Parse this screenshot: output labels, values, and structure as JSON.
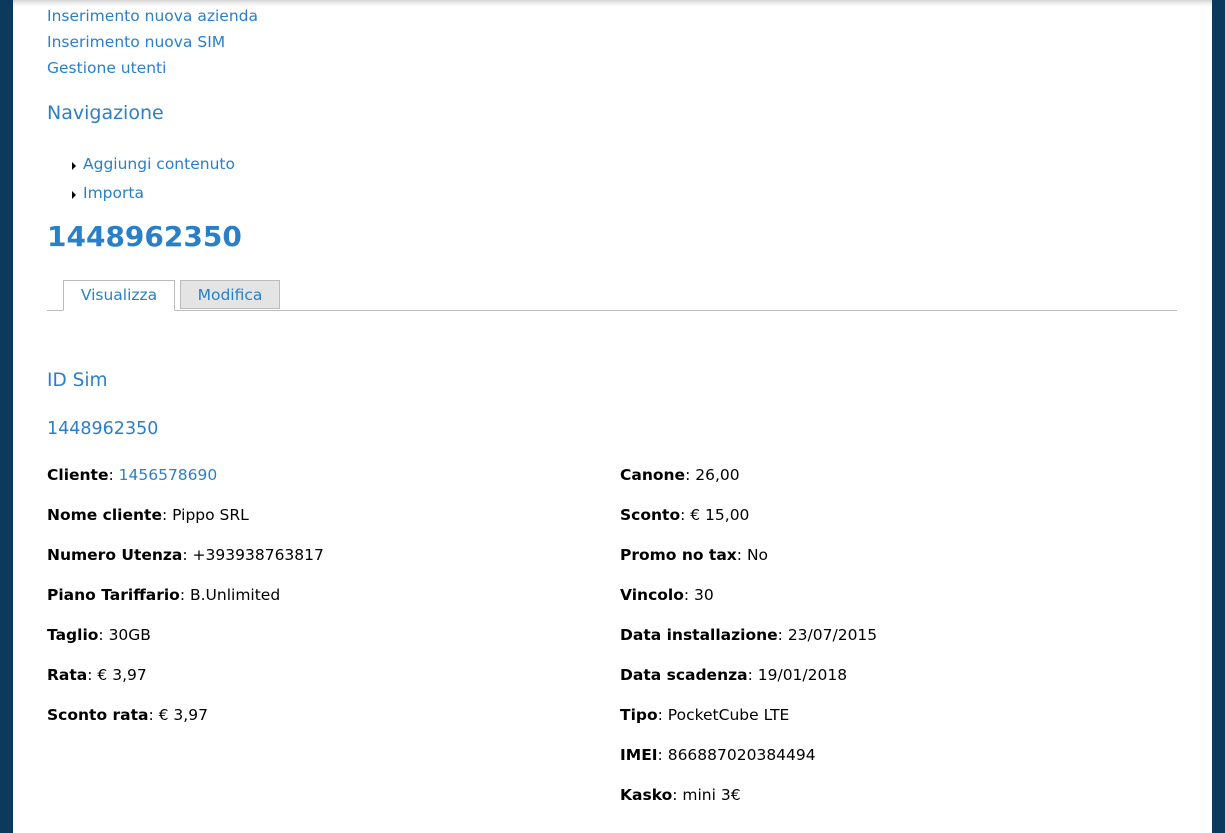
{
  "admin_links": [
    "Inserimento nuova azienda",
    "Inserimento nuova SIM",
    "Gestione utenti"
  ],
  "navigation": {
    "title": "Navigazione",
    "items": [
      "Aggiungi contenuto",
      "Importa"
    ]
  },
  "node": {
    "title": "1448962350",
    "tabs": {
      "view": "Visualizza",
      "edit": "Modifica"
    }
  },
  "sim": {
    "label": "ID Sim",
    "value": "1448962350"
  },
  "left_fields": [
    {
      "label": "Cliente",
      "value": "1456578690",
      "link": true
    },
    {
      "label": "Nome cliente",
      "value": "Pippo SRL"
    },
    {
      "label": "Numero Utenza",
      "value": "+393938763817"
    },
    {
      "label": "Piano Tariffario",
      "value": "B.Unlimited"
    },
    {
      "label": "Taglio",
      "value": "30GB"
    },
    {
      "label": "Rata",
      "value": "€ 3,97"
    },
    {
      "label": "Sconto rata",
      "value": "€ 3,97"
    }
  ],
  "right_fields": [
    {
      "label": "Canone",
      "value": "26,00"
    },
    {
      "label": "Sconto",
      "value": "€ 15,00"
    },
    {
      "label": "Promo no tax",
      "value": "No"
    },
    {
      "label": "Vincolo",
      "value": "30"
    },
    {
      "label": "Data installazione",
      "value": "23/07/2015"
    },
    {
      "label": "Data scadenza",
      "value": "19/01/2018"
    },
    {
      "label": "Tipo",
      "value": "PocketCube LTE"
    },
    {
      "label": "IMEI",
      "value": "866887020384494"
    },
    {
      "label": "Kasko",
      "value": "mini 3€"
    }
  ]
}
